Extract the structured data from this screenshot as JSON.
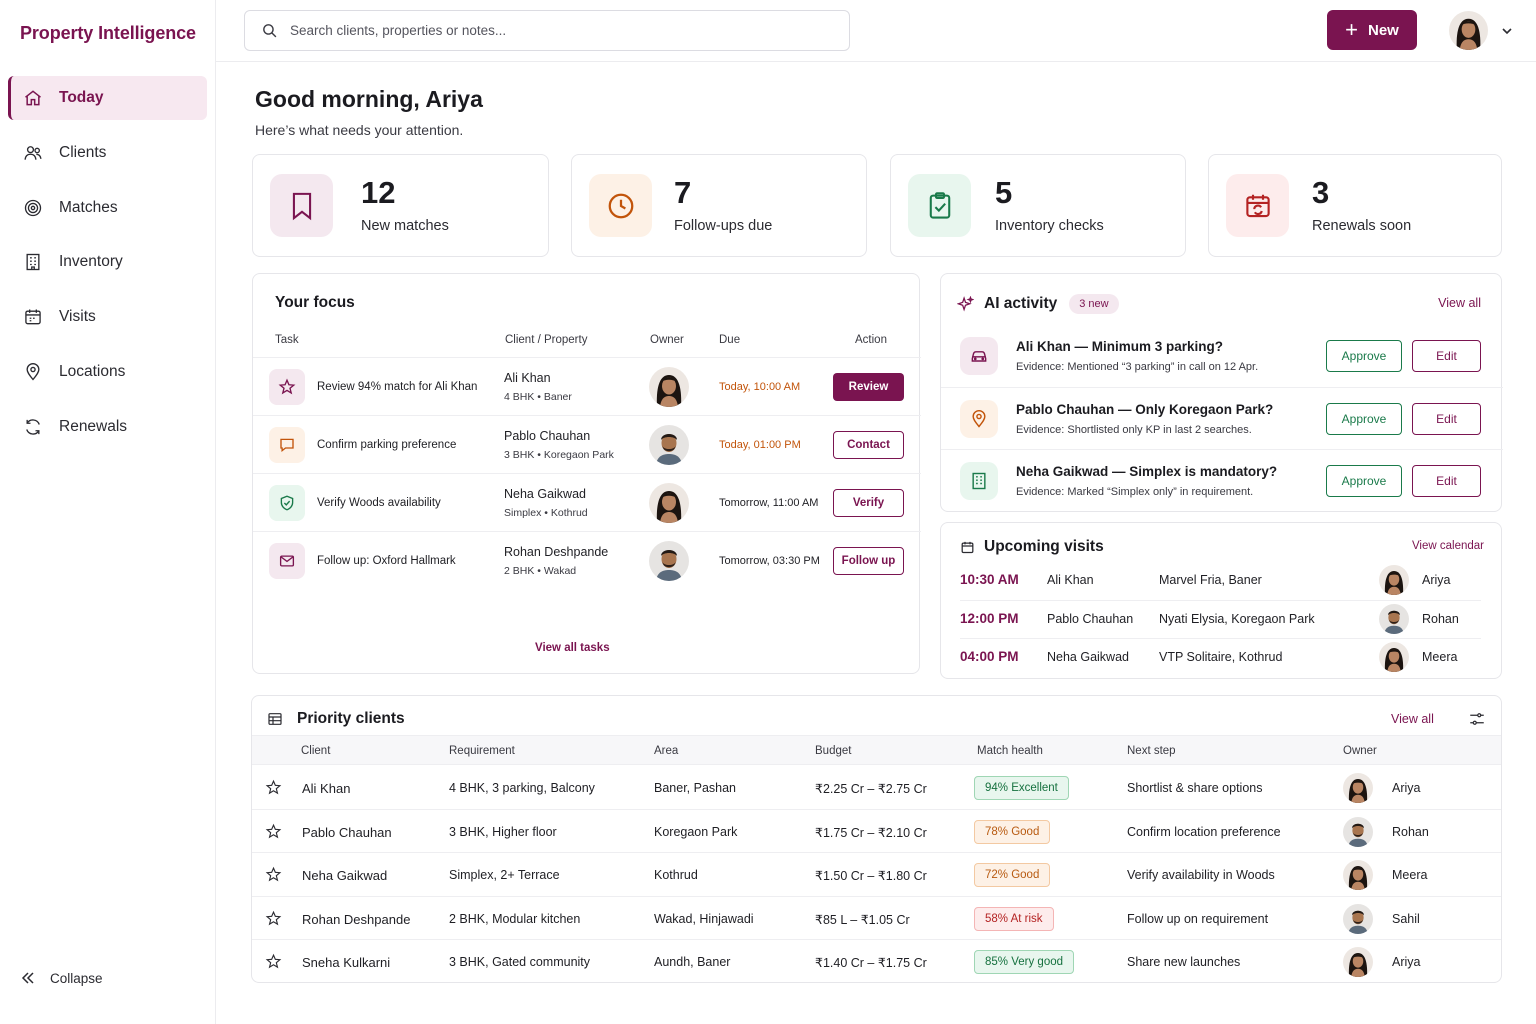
{
  "colors": {
    "brand": "#7a1450",
    "success": "#1a7a4a",
    "warning": "#c2540a",
    "danger": "#b42323"
  },
  "brand": "Property Intelligence",
  "sidebar": {
    "items": [
      {
        "label": "Today",
        "icon": "home-icon",
        "active": true
      },
      {
        "label": "Clients",
        "icon": "users-icon"
      },
      {
        "label": "Matches",
        "icon": "target-icon"
      },
      {
        "label": "Inventory",
        "icon": "building-icon"
      },
      {
        "label": "Visits",
        "icon": "calendar-icon"
      },
      {
        "label": "Locations",
        "icon": "pin-icon"
      },
      {
        "label": "Renewals",
        "icon": "refresh-icon"
      }
    ],
    "collapse_label": "Collapse"
  },
  "topbar": {
    "search_placeholder": "Search clients, properties or notes...",
    "new_label": "New"
  },
  "greeting": {
    "title": "Good morning, Ariya",
    "subtitle": "Here’s what needs your attention."
  },
  "stats": [
    {
      "value": "12",
      "label": "New matches",
      "icon": "bookmark-icon"
    },
    {
      "value": "7",
      "label": "Follow-ups due",
      "icon": "clock-icon"
    },
    {
      "value": "5",
      "label": "Inventory checks",
      "icon": "clipboard-check-icon"
    },
    {
      "value": "3",
      "label": "Renewals soon",
      "icon": "calendar-refresh-icon"
    }
  ],
  "focus": {
    "title": "Your focus",
    "headers": {
      "task": "Task",
      "client": "Client / Property",
      "owner": "Owner",
      "due": "Due",
      "action": "Action"
    },
    "rows": [
      {
        "task": "Review 94% match for Ali Khan",
        "client": "Ali Khan",
        "property": "4 BHK • Baner",
        "due": "Today, 10:00 AM",
        "action": "Review",
        "icon": "star-icon"
      },
      {
        "task": "Confirm parking preference",
        "client": "Pablo Chauhan",
        "property": "3 BHK • Koregaon Park",
        "due": "Today, 01:00 PM",
        "action": "Contact",
        "icon": "chat-icon"
      },
      {
        "task": "Verify Woods availability",
        "client": "Neha Gaikwad",
        "property": "Simplex • Kothrud",
        "due": "Tomorrow, 11:00 AM",
        "action": "Verify",
        "icon": "shield-check-icon"
      },
      {
        "task": "Follow up: Oxford Hallmark",
        "client": "Rohan Deshpande",
        "property": "2 BHK • Wakad",
        "due": "Tomorrow, 03:30 PM",
        "action": "Follow up",
        "icon": "mail-icon"
      }
    ],
    "view_all": "View all tasks"
  },
  "ai": {
    "title": "AI activity",
    "badge": "3 new",
    "view_all": "View all",
    "items": [
      {
        "title": "Ali Khan — Minimum 3 parking?",
        "evidence": "Evidence: Mentioned “3 parking” in call on 12 Apr.",
        "icon": "car-icon"
      },
      {
        "title": "Pablo Chauhan — Only Koregaon Park?",
        "evidence": "Evidence: Shortlisted only KP in last 2 searches.",
        "icon": "pin-icon"
      },
      {
        "title": "Neha Gaikwad — Simplex is mandatory?",
        "evidence": "Evidence: Marked “Simplex only” in requirement.",
        "icon": "building-icon"
      }
    ],
    "approve": "Approve",
    "edit": "Edit"
  },
  "visits": {
    "title": "Upcoming visits",
    "view_calendar": "View calendar",
    "rows": [
      {
        "time": "10:30 AM",
        "client": "Ali Khan",
        "place": "Marvel Fria, Baner",
        "owner": "Ariya"
      },
      {
        "time": "12:00 PM",
        "client": "Pablo Chauhan",
        "place": "Nyati Elysia, Koregaon Park",
        "owner": "Rohan"
      },
      {
        "time": "04:00 PM",
        "client": "Neha Gaikwad",
        "place": "VTP Solitaire, Kothrud",
        "owner": "Meera"
      }
    ]
  },
  "priority": {
    "title": "Priority clients",
    "view_all": "View all",
    "headers": {
      "client": "Client",
      "requirement": "Requirement",
      "area": "Area",
      "budget": "Budget",
      "health": "Match health",
      "next": "Next step",
      "owner": "Owner"
    },
    "rows": [
      {
        "client": "Ali Khan",
        "requirement": "4 BHK, 3 parking, Balcony",
        "area": "Baner, Pashan",
        "budget": "₹2.25 Cr – ₹2.75 Cr",
        "health": "94% Excellent",
        "tone": "green",
        "next": "Shortlist & share options",
        "owner": "Ariya"
      },
      {
        "client": "Pablo Chauhan",
        "requirement": "3 BHK, Higher floor",
        "area": "Koregaon Park",
        "budget": "₹1.75 Cr – ₹2.10 Cr",
        "health": "78% Good",
        "tone": "orange",
        "next": "Confirm location preference",
        "owner": "Rohan"
      },
      {
        "client": "Neha Gaikwad",
        "requirement": "Simplex, 2+ Terrace",
        "area": "Kothrud",
        "budget": "₹1.50 Cr – ₹1.80 Cr",
        "health": "72% Good",
        "tone": "orange",
        "next": "Verify availability in Woods",
        "owner": "Meera"
      },
      {
        "client": "Rohan Deshpande",
        "requirement": "2 BHK, Modular kitchen",
        "area": "Wakad, Hinjawadi",
        "budget": "₹85 L – ₹1.05 Cr",
        "health": "58% At risk",
        "tone": "red",
        "next": "Follow up on requirement",
        "owner": "Sahil"
      },
      {
        "client": "Sneha Kulkarni",
        "requirement": "3 BHK, Gated community",
        "area": "Aundh, Baner",
        "budget": "₹1.40 Cr – ₹1.75 Cr",
        "health": "85% Very good",
        "tone": "green",
        "next": "Share new launches",
        "owner": "Ariya"
      }
    ]
  }
}
